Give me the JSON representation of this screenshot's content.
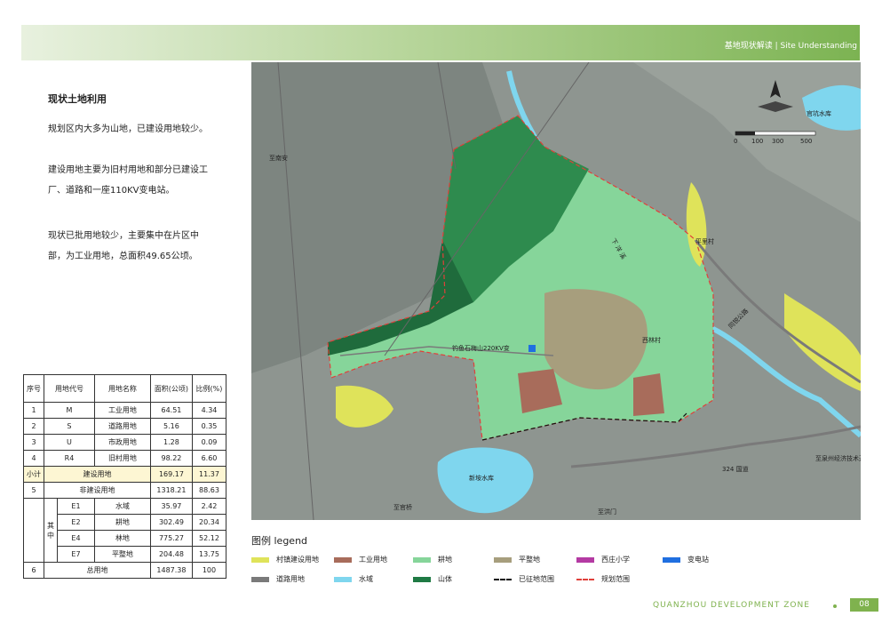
{
  "header": {
    "title": "基地现状解读 | Site Understanding"
  },
  "sidebar": {
    "heading": "现状土地利用",
    "paragraphs": [
      "规划区内大多为山地，已建设用地较少。",
      "建设用地主要为旧村用地和部分已建设工厂、道路和一座110KV变电站。",
      "现状已批用地较少，主要集中在片区中部，为工业用地，总面积49.65公顷。"
    ]
  },
  "table": {
    "headers": [
      "序号",
      "用地代号",
      "用地名称",
      "面积(公顷)",
      "比例(%)"
    ],
    "rows": [
      {
        "no": "1",
        "code": "M",
        "name": "工业用地",
        "area": "64.51",
        "pct": "4.34"
      },
      {
        "no": "2",
        "code": "S",
        "name": "道路用地",
        "area": "5.16",
        "pct": "0.35"
      },
      {
        "no": "3",
        "code": "U",
        "name": "市政用地",
        "area": "1.28",
        "pct": "0.09"
      },
      {
        "no": "4",
        "code": "R4",
        "name": "旧村用地",
        "area": "98.22",
        "pct": "6.60"
      }
    ],
    "subtotal": {
      "no": "小计",
      "name": "建设用地",
      "area": "169.17",
      "pct": "11.37"
    },
    "nonbuild": {
      "no": "5",
      "name": "非建设用地",
      "area": "1318.21",
      "pct": "88.63"
    },
    "among_label": "其中",
    "sub_rows": [
      {
        "code": "E1",
        "name": "水域",
        "area": "35.97",
        "pct": "2.42"
      },
      {
        "code": "E2",
        "name": "耕地",
        "area": "302.49",
        "pct": "20.34"
      },
      {
        "code": "E4",
        "name": "林地",
        "area": "775.27",
        "pct": "52.12"
      },
      {
        "code": "E7",
        "name": "平整地",
        "area": "204.48",
        "pct": "13.75"
      }
    ],
    "total": {
      "no": "6",
      "name": "总用地",
      "area": "1487.38",
      "pct": "100"
    }
  },
  "map": {
    "labels": {
      "reservoir_north": "官坑水库",
      "reservoir_south": "新垵水库",
      "to_nanan": "至南安",
      "to_quanzhou": "至泉州经济技术开发区",
      "to_guanqiao": "至官桥",
      "to_hongmen": "至洪门",
      "road_324": "324 国道",
      "road_tongxing": "同锐公路",
      "village_xilin": "西林村",
      "village_pingli": "平里村",
      "substation_line": "钓鱼石梅山220KV变",
      "river": "下 洋 溪"
    },
    "scale": {
      "ticks": [
        "0",
        "100",
        "300",
        "500"
      ]
    }
  },
  "legend": {
    "title": "图例  legend",
    "items": [
      {
        "label": "村镇建设用地",
        "color": "#dfe35a",
        "kind": "fill"
      },
      {
        "label": "工业用地",
        "color": "#a86c5b",
        "kind": "fill"
      },
      {
        "label": "耕地",
        "color": "#86d59a",
        "kind": "fill"
      },
      {
        "label": "平整地",
        "color": "#a79e7d",
        "kind": "fill"
      },
      {
        "label": "西庄小学",
        "color": "#b43aa3",
        "kind": "fill"
      },
      {
        "label": "变电站",
        "color": "#1f6fe0",
        "kind": "fill"
      },
      {
        "label": "道路用地",
        "color": "#7a7a7a",
        "kind": "fill"
      },
      {
        "label": "水域",
        "color": "#7fd6ee",
        "kind": "fill"
      },
      {
        "label": "山体",
        "color": "#1f7a44",
        "kind": "fill"
      },
      {
        "label": "已征地范围",
        "color": "#111111",
        "kind": "dash"
      },
      {
        "label": "规划范围",
        "color": "#e0403a",
        "kind": "dash"
      }
    ]
  },
  "footer": {
    "text": "QUANZHOU DEVELOPMENT ZONE",
    "page": "08"
  }
}
